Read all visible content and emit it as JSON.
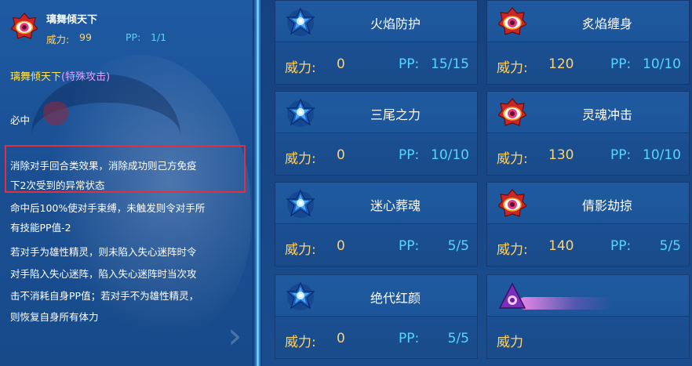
{
  "detail": {
    "name": "璃舞倾天下",
    "power_label": "威力:",
    "power_value": "99",
    "pp_label": "PP:",
    "pp_value": "1/1",
    "type_name": "璃舞倾天下",
    "type_category": "(特殊攻击)",
    "lines": [
      "必中",
      "消除对手回合类效果，消除成功则己方免疫",
      "下2次受到的异常状态",
      "命中后100%使对手束缚，未触发则令对手所",
      "有技能PP值-2",
      "若对手为雄性精灵，则未陷入失心迷阵时令",
      "对手陷入失心迷阵，陷入失心迷阵时当次攻",
      "击不消耗自身PP值；若对手不为雄性精灵，",
      "则恢复自身所有体力"
    ],
    "highlight_color": "#e0303d"
  },
  "skills": [
    {
      "name": "火焰防护",
      "icon": "blue-star-icon",
      "power_label": "威力:",
      "power": "0",
      "pp_label": "PP:",
      "pp": "15/15"
    },
    {
      "name": "炙焰缠身",
      "icon": "red-eye-icon",
      "power_label": "威力:",
      "power": "120",
      "pp_label": "PP:",
      "pp": "10/10"
    },
    {
      "name": "三尾之力",
      "icon": "blue-star-icon",
      "power_label": "威力:",
      "power": "0",
      "pp_label": "PP:",
      "pp": "10/10"
    },
    {
      "name": "灵魂冲击",
      "icon": "red-eye-icon",
      "power_label": "威力:",
      "power": "130",
      "pp_label": "PP:",
      "pp": "10/10"
    },
    {
      "name": "迷心葬魂",
      "icon": "blue-star-icon",
      "power_label": "威力:",
      "power": "0",
      "pp_label": "PP:",
      "pp": "5/5"
    },
    {
      "name": "倩影劫掠",
      "icon": "red-eye-icon",
      "power_label": "威力:",
      "power": "140",
      "pp_label": "PP:",
      "pp": "5/5"
    },
    {
      "name": "绝代红颜",
      "icon": "blue-star-icon",
      "power_label": "威力:",
      "power": "0",
      "pp_label": "PP:",
      "pp": "5/5"
    },
    {
      "name": "",
      "icon": "purple-eye-icon",
      "power_label": "威力",
      "power": "",
      "pp_label": "",
      "pp": ""
    }
  ],
  "colors": {
    "power": "#ffd36b",
    "pp": "#53d6ff",
    "type_name": "#ffe45a",
    "type_category": "#d9a3ff"
  }
}
